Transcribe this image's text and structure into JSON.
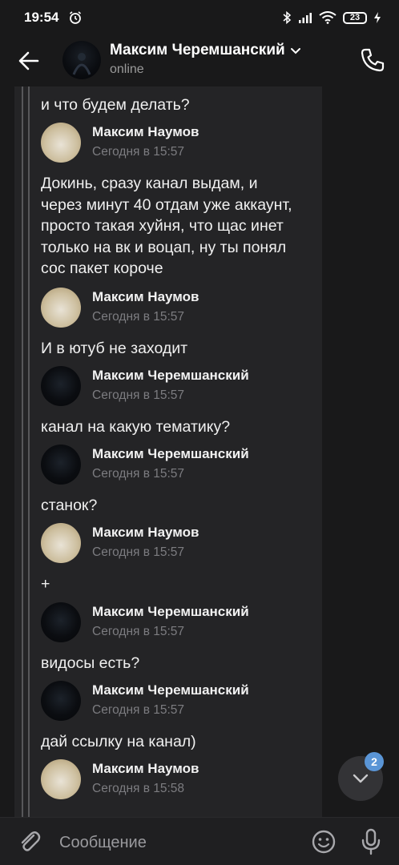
{
  "status_bar": {
    "time": "19:54",
    "battery": "23"
  },
  "header": {
    "title": "Максим Черемшанский",
    "subtitle": "online"
  },
  "thread": {
    "items": [
      {
        "type": "text",
        "text": "и что будем делать?"
      },
      {
        "type": "head",
        "name": "Максим Наумов",
        "time": "Сегодня в 15:57",
        "avatar": "light"
      },
      {
        "type": "text",
        "text": "Докинь, сразу канал выдам, и\nчерез минут 40 отдам уже аккаунт,\nпросто такая хуйня, что щас инет\nтолько на вк и воцап, ну ты понял\nсос пакет короче"
      },
      {
        "type": "head",
        "name": "Максим Наумов",
        "time": "Сегодня в 15:57",
        "avatar": "light"
      },
      {
        "type": "text",
        "text": "И в ютуб не заходит"
      },
      {
        "type": "head",
        "name": "Максим Черемшанский",
        "time": "Сегодня в 15:57",
        "avatar": "dark"
      },
      {
        "type": "text",
        "text": "канал на какую тематику?"
      },
      {
        "type": "head",
        "name": "Максим Черемшанский",
        "time": "Сегодня в 15:57",
        "avatar": "dark"
      },
      {
        "type": "text",
        "text": "станок?"
      },
      {
        "type": "head",
        "name": "Максим Наумов",
        "time": "Сегодня в 15:57",
        "avatar": "light"
      },
      {
        "type": "text",
        "text": "+"
      },
      {
        "type": "head",
        "name": "Максим Черемшанский",
        "time": "Сегодня в 15:57",
        "avatar": "dark"
      },
      {
        "type": "text",
        "text": "видосы есть?"
      },
      {
        "type": "head",
        "name": "Максим Черемшанский",
        "time": "Сегодня в 15:57",
        "avatar": "dark"
      },
      {
        "type": "text",
        "text": "дай ссылку на канал)"
      },
      {
        "type": "head",
        "name": "Максим Наумов",
        "time": "Сегодня в 15:58",
        "avatar": "light"
      }
    ]
  },
  "scroll_down": {
    "badge": "2"
  },
  "composer": {
    "placeholder": "Сообщение"
  },
  "colors": {
    "background": "#19191a",
    "thread_bg": "#242426",
    "accent": "#5a95d6",
    "muted": "#7c7c80"
  },
  "icons": {
    "status": [
      "alarm-icon",
      "bluetooth-icon",
      "signal-icon",
      "wifi-icon",
      "battery-icon",
      "charging-icon"
    ],
    "header": [
      "back-arrow-icon",
      "chevron-down-icon",
      "phone-icon"
    ],
    "composer": [
      "paperclip-icon",
      "emoji-icon",
      "microphone-icon"
    ],
    "scroll": [
      "chevron-down-icon"
    ]
  }
}
